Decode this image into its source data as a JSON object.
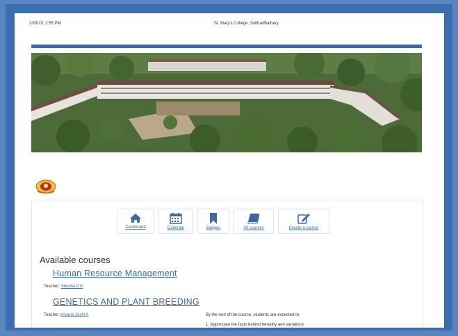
{
  "print_header": {
    "datetime": "2/28/23, 2:55 PM",
    "site_name": "St. Mary's College, SulthanBathery"
  },
  "nav": [
    {
      "label": "Dashboard",
      "icon": "home-icon"
    },
    {
      "label": "Calendar",
      "icon": "calendar-icon"
    },
    {
      "label": "Badges",
      "icon": "bookmark-icon"
    },
    {
      "label": "All courses",
      "icon": "book-icon"
    },
    {
      "label": "Create a course",
      "icon": "edit-icon"
    }
  ],
  "available_courses_title": "Available courses",
  "courses": [
    {
      "name": "Human Resource Management",
      "teacher_label": "Teacher:",
      "teacher": "Shobha P.D"
    },
    {
      "name": "GENETICS AND PLANT BREEDING",
      "teacher_label": "Teacher:",
      "teacher": "Aryana Joshi A",
      "summary": [
        "By the end of the course, students are expected to:",
        "1. Appreciate the facts behind heredity and variations"
      ]
    }
  ],
  "colors": {
    "frame": "#3b6db0",
    "link": "#3d6a9e",
    "topbar": "#3f6e9e"
  }
}
